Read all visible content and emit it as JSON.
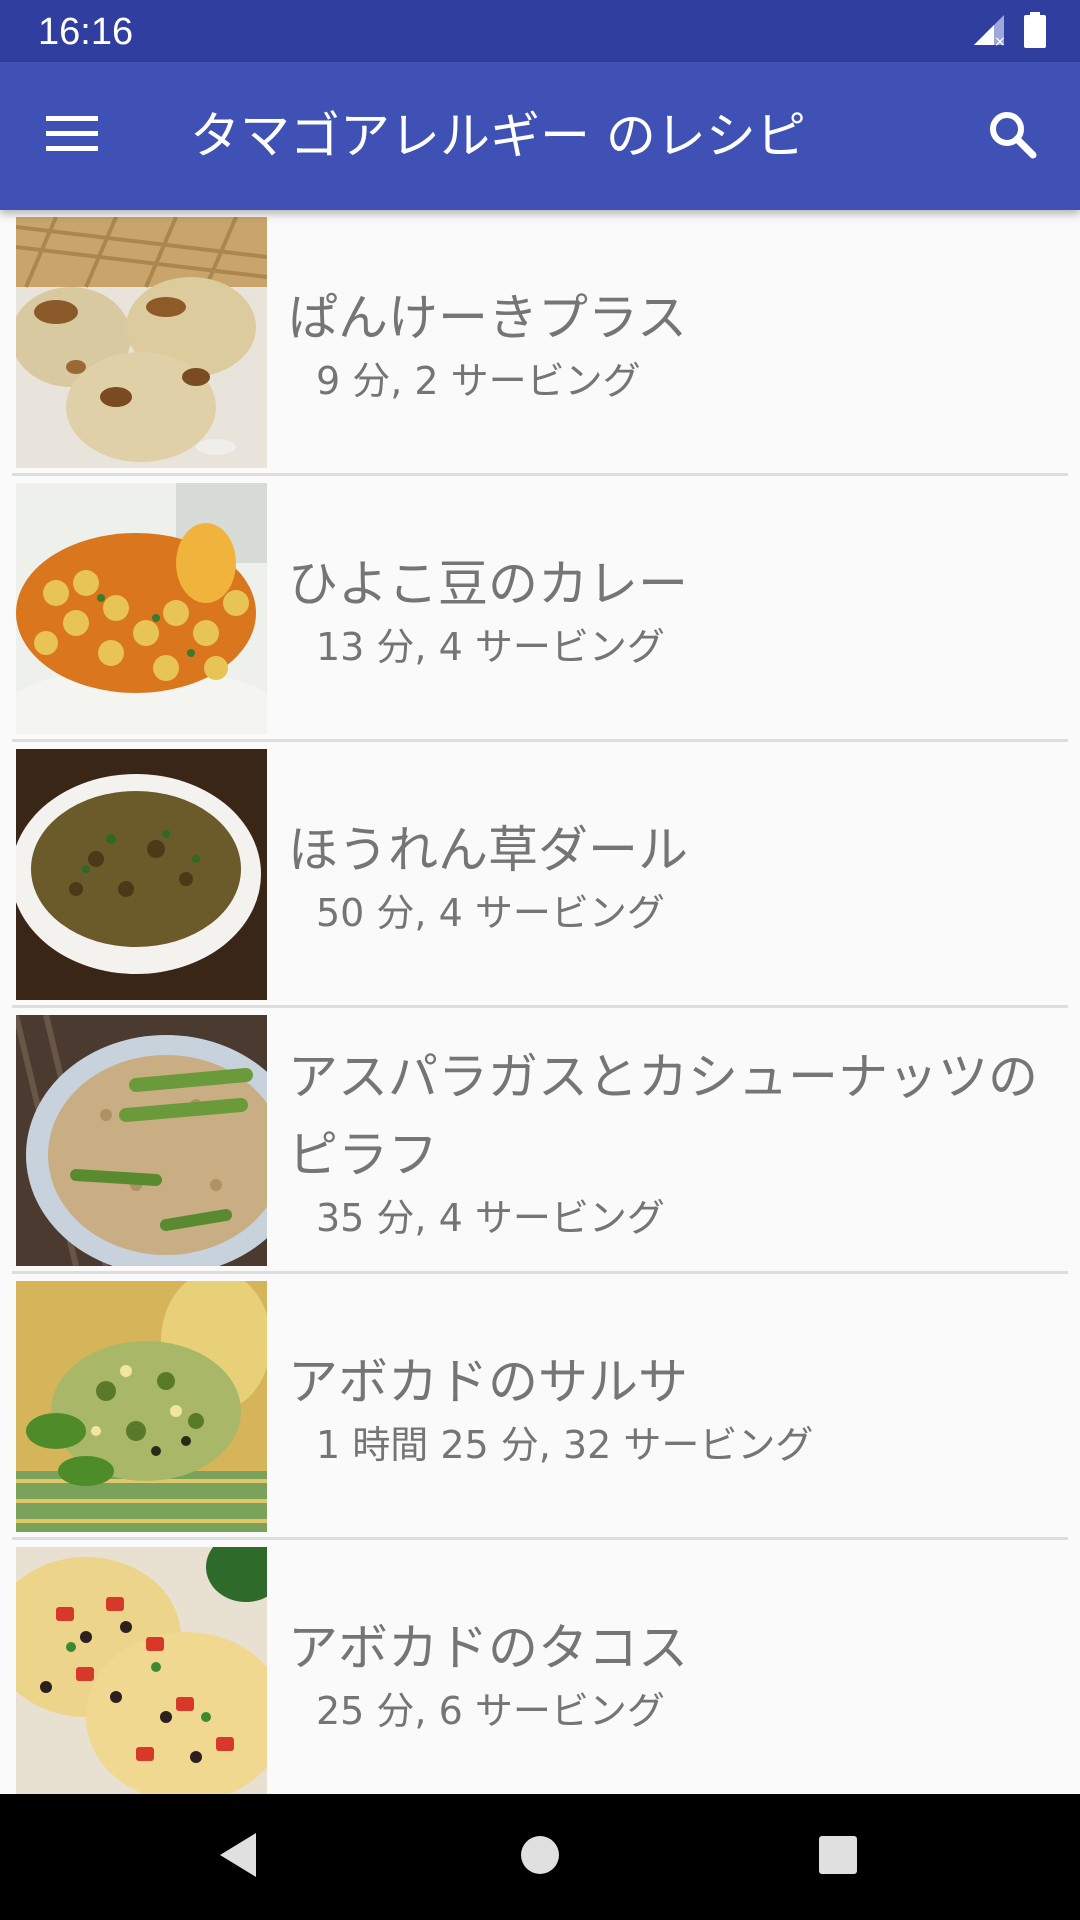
{
  "status_bar": {
    "time": "16:16",
    "icons": [
      "signal-icon",
      "battery-icon"
    ]
  },
  "app_bar": {
    "title": "タマゴアレルギー のレシピ",
    "menu_icon": "menu-icon",
    "search_icon": "search-icon",
    "color": "#3f51b5"
  },
  "recipes": [
    {
      "name": "ぱんけーきプラス",
      "meta": "9 分, 2 サービング",
      "image": "pancakes"
    },
    {
      "name": "ひよこ豆のカレー",
      "meta": "13 分, 4 サービング",
      "image": "chickpea-curry"
    },
    {
      "name": "ほうれん草ダール",
      "meta": "50 分, 4 サービング",
      "image": "spinach-dal"
    },
    {
      "name": "アスパラガスとカシューナッツのピラフ",
      "meta": "35 分, 4 サービング",
      "image": "asparagus-pilaf"
    },
    {
      "name": "アボカドのサルサ",
      "meta": "1 時間 25 分, 32 サービング",
      "image": "avocado-salsa"
    },
    {
      "name": "アボカドのタコス",
      "meta": "25 分, 6 サービング",
      "image": "avocado-tacos"
    }
  ],
  "nav_bar": {
    "buttons": [
      "back-icon",
      "home-icon",
      "recents-icon"
    ]
  }
}
